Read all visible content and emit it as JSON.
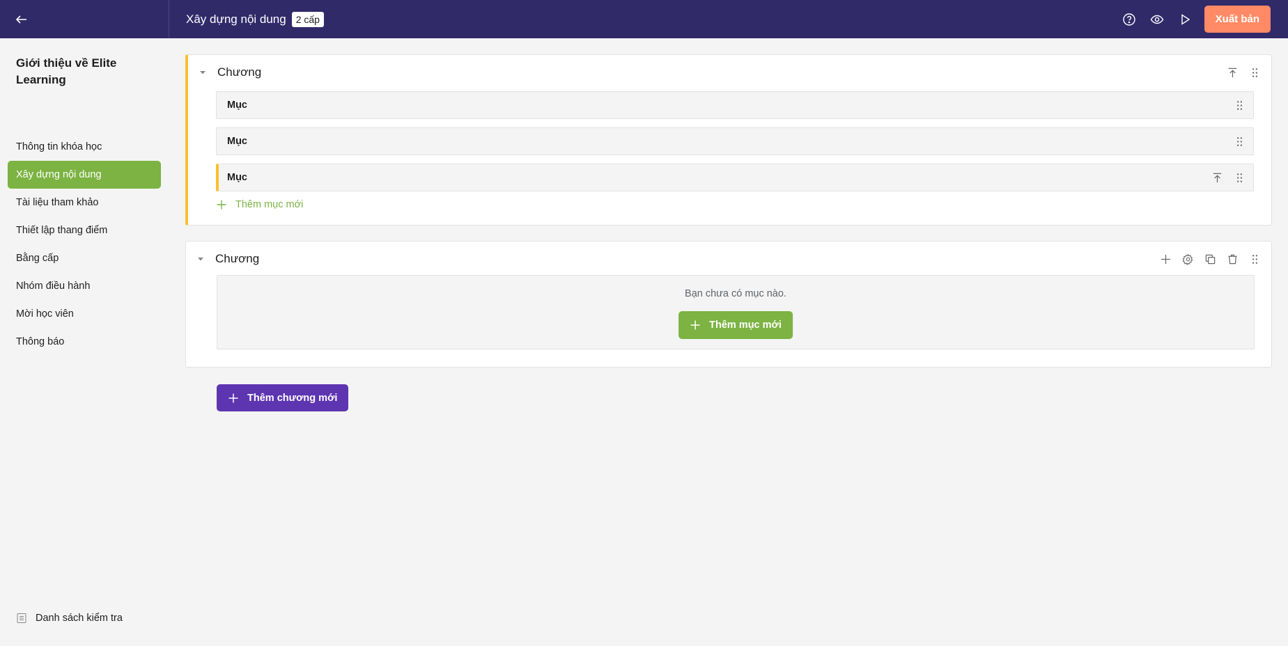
{
  "header": {
    "back_icon": "arrow-left-icon",
    "title": "Xây dựng nội dung",
    "level_badge": "2 cấp",
    "actions": [
      "help-icon",
      "eye-icon",
      "play-icon"
    ],
    "publish_label": "Xuất bản"
  },
  "sidebar": {
    "course_title": "Giới thiệu về Elite Learning",
    "items": [
      {
        "label": "Thông tin khóa học",
        "active": false
      },
      {
        "label": "Xây dựng nội dung",
        "active": true
      },
      {
        "label": "Tài liệu tham khảo",
        "active": false
      },
      {
        "label": "Thiết lập thang điểm",
        "active": false
      },
      {
        "label": "Bằng cấp",
        "active": false
      },
      {
        "label": "Nhóm điều hành",
        "active": false
      },
      {
        "label": "Mời học viên",
        "active": false
      },
      {
        "label": "Thông báo",
        "active": false
      }
    ],
    "checklist_label": "Danh sách kiểm tra"
  },
  "chapters": [
    {
      "title": "Chương",
      "items": [
        {
          "label": "Mục"
        },
        {
          "label": "Mục"
        },
        {
          "label": "Mục"
        }
      ],
      "add_item_label": "Thêm mục mới"
    },
    {
      "title": "Chương",
      "empty_text": "Bạn chưa có mục nào.",
      "add_item_label": "Thêm mục mới"
    }
  ],
  "add_chapter_label": "Thêm chương mới",
  "colors": {
    "header_bg": "#312a69",
    "publish": "#ff8a65",
    "green": "#7cb342",
    "purple": "#5e35b1",
    "highlight": "#fbc02d"
  }
}
